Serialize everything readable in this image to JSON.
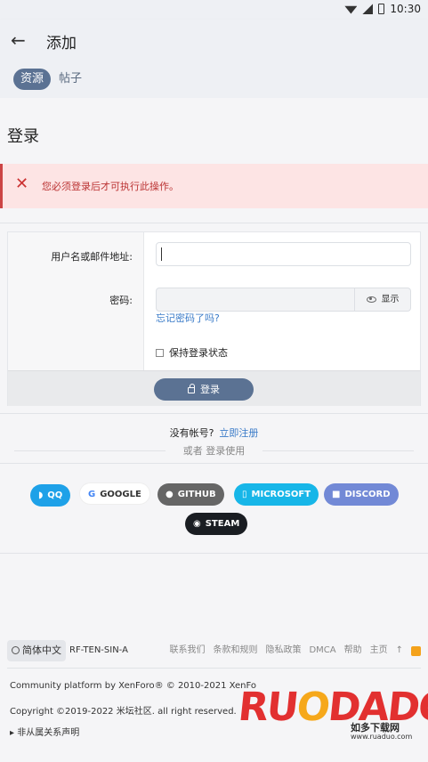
{
  "status": {
    "time": "10:30"
  },
  "appbar": {
    "title": "添加",
    "tabs": [
      "资源",
      "帖子"
    ]
  },
  "page": {
    "title": "登录"
  },
  "alert": {
    "message": "您必须登录后才可执行此操作。"
  },
  "form": {
    "username_label": "用户名或邮件地址:",
    "username_value": "",
    "password_label": "密码:",
    "show_label": "显示",
    "forgot": "忘记密码了吗?",
    "keep_logged": "保持登录状态",
    "login_button": "登录"
  },
  "signup": {
    "prompt": "没有帐号?",
    "link": "立即注册",
    "or_use": "或者 登录使用"
  },
  "social": {
    "qq": "QQ",
    "google": "GOOGLE",
    "github": "GITHUB",
    "microsoft": "MICROSOFT",
    "discord": "DISCORD",
    "steam": "STEAM"
  },
  "footer": {
    "language": "简体中文",
    "style": "RF-TEN-SIN-A",
    "links": [
      "联系我们",
      "条款和规则",
      "隐私政策",
      "DMCA",
      "帮助",
      "主页"
    ],
    "copyright1": "Community platform by XenForo® © 2010-2021 XenFo",
    "copyright2": "Copyright ©2019-2022 米坛社区. all right reserved.",
    "disclaimer": "▸ 非从属关系声明"
  },
  "watermark": {
    "text_r": "RU",
    "text_o": "O",
    "text_rest": "DADO",
    "sub": "如多下载网",
    "url": "www.ruaduo.com"
  },
  "colors": {
    "accent": "#5b7293",
    "link": "#3a7bc8",
    "alert_bg": "#fde4e4"
  }
}
